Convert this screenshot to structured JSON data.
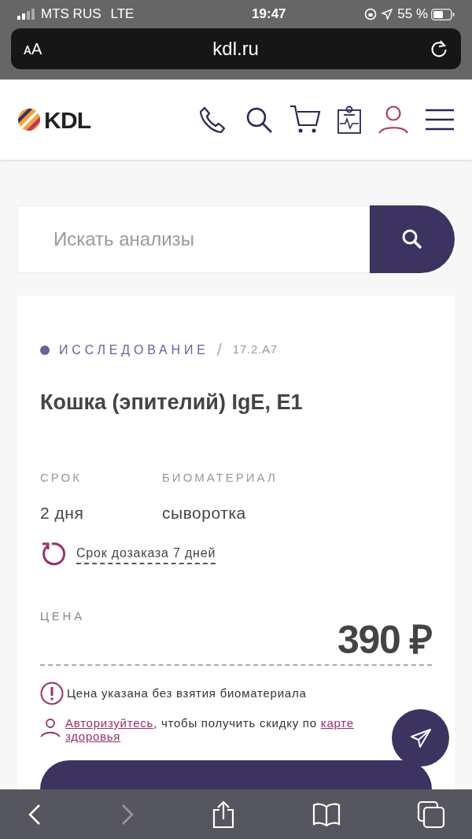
{
  "status_bar": {
    "carrier": "MTS RUS",
    "network": "LTE",
    "time": "19:47",
    "battery": "55 %"
  },
  "address_bar": {
    "text_size": "ᴀA",
    "url": "kdl.ru"
  },
  "header": {
    "logo": "KDL"
  },
  "search": {
    "placeholder": "Искать анализы"
  },
  "card": {
    "category": "ИССЛЕДОВАНИЕ",
    "separator": "/",
    "code": "17.2.A7",
    "title": "Кошка (эпителий) IgE, E1",
    "details": [
      {
        "label": "СРОК",
        "value": "2 дня"
      },
      {
        "label": "БИОМАТЕРИАЛ",
        "value": "сыворотка"
      }
    ],
    "reorder": "Срок дозаказа 7 дней",
    "price_label": "ЦЕНА",
    "price": "390 ₽",
    "notice": "Цена указана без взятия биоматериала",
    "login_link": "Авторизуйтесь",
    "login_text": ", чтобы получить скидку по ",
    "card_link_lines": [
      "карте",
      "здоровья"
    ]
  }
}
